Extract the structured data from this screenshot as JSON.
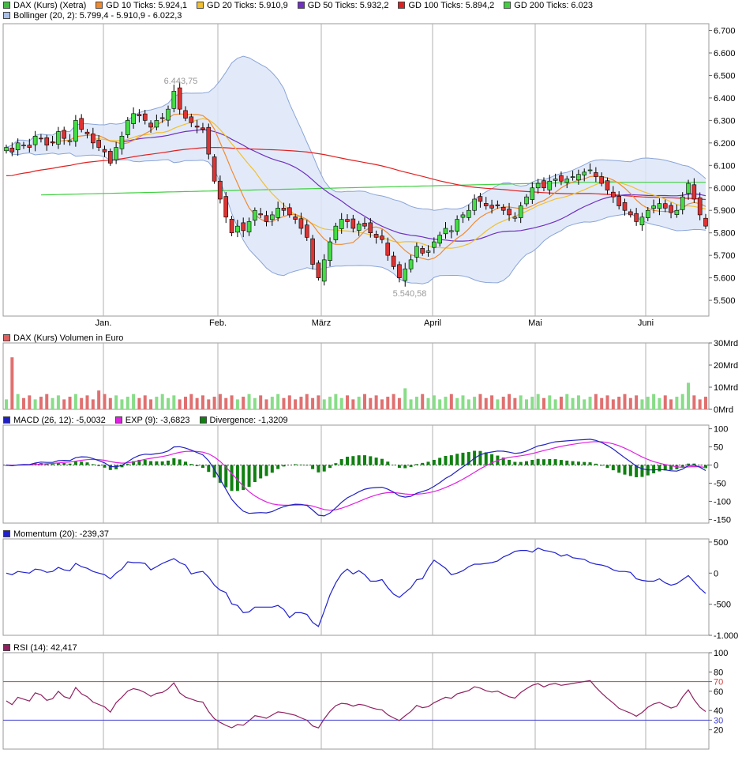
{
  "legends": {
    "price": [
      {
        "label": "DAX (Kurs) (Xetra)",
        "color": "#44bb44"
      },
      {
        "label": "GD 10 Ticks: 5.924,1",
        "color": "#f08a30"
      },
      {
        "label": "GD 20 Ticks: 5.910,9",
        "color": "#f0c030"
      },
      {
        "label": "GD 50 Ticks: 5.932,2",
        "color": "#7030c0"
      },
      {
        "label": "GD 100 Ticks: 5.894,2",
        "color": "#e02020"
      },
      {
        "label": "GD 200 Ticks: 6.023",
        "color": "#40d040"
      }
    ],
    "bollinger": {
      "label": "Bollinger (20, 2): 5.799,4 - 5.910,9 - 6.022,3",
      "color": "#a8c0e8"
    },
    "volume": {
      "label": "DAX (Kurs) Volumen in Euro",
      "color": "#e06060"
    },
    "macd": [
      {
        "label": "MACD (26, 12): -5,0032",
        "color": "#2020c0"
      },
      {
        "label": "EXP (9): -3,6823",
        "color": "#e020e0"
      },
      {
        "label": "Divergence: -1,3209",
        "color": "#108010"
      }
    ],
    "momentum": {
      "label": "Momentum (20): -239,37",
      "color": "#2020d0"
    },
    "rsi": {
      "label": "RSI (14): 42,417",
      "color": "#902060"
    }
  },
  "chart_data": [
    {
      "type": "candlestick",
      "name": "price",
      "x_months": [
        "Jan.",
        "Feb.",
        "März",
        "April",
        "Mai",
        "Juni"
      ],
      "ylim": [
        5430,
        6730
      ],
      "yticks": [
        "5.500",
        "5.600",
        "5.700",
        "5.800",
        "5.900",
        "6.000",
        "6.100",
        "6.200",
        "6.300",
        "6.400",
        "6.500",
        "6.600",
        "6.700"
      ],
      "annotations": [
        "6.443,75",
        "5.540,58"
      ],
      "close": [
        6180,
        6160,
        6200,
        6190,
        6180,
        6230,
        6220,
        6190,
        6200,
        6250,
        6220,
        6210,
        6300,
        6260,
        6240,
        6200,
        6180,
        6160,
        6110,
        6180,
        6230,
        6300,
        6330,
        6320,
        6300,
        6270,
        6300,
        6310,
        6350,
        6430,
        6350,
        6310,
        6290,
        6270,
        6260,
        6150,
        6030,
        5950,
        5870,
        5800,
        5830,
        5810,
        5850,
        5900,
        5880,
        5850,
        5880,
        5910,
        5900,
        5880,
        5860,
        5820,
        5780,
        5660,
        5600,
        5680,
        5760,
        5830,
        5860,
        5850,
        5820,
        5840,
        5830,
        5800,
        5780,
        5770,
        5700,
        5650,
        5600,
        5640,
        5680,
        5740,
        5710,
        5720,
        5760,
        5790,
        5820,
        5810,
        5860,
        5880,
        5900,
        5950,
        5940,
        5920,
        5910,
        5920,
        5900,
        5880,
        5870,
        5920,
        5960,
        6000,
        6020,
        6000,
        6030,
        6040,
        6030,
        6040,
        6050,
        6060,
        6070,
        6080,
        6050,
        6020,
        5990,
        5960,
        5920,
        5900,
        5880,
        5850,
        5870,
        5900,
        5920,
        5930,
        5910,
        5890,
        5900,
        5960,
        6020,
        5950,
        5880,
        5830
      ],
      "ma_values": [
        "5.924,1",
        "5.910,9",
        "5.932,2",
        "5.894,2",
        "6.023"
      ]
    },
    {
      "type": "bar",
      "name": "volume",
      "yticks": [
        "0Mrd",
        "10Mrd",
        "20Mrd",
        "30Mrd"
      ],
      "ylim": [
        0,
        30
      ],
      "unit": "Mrd"
    },
    {
      "type": "line",
      "name": "macd",
      "yticks": [
        "-150",
        "-100",
        "-50",
        "0",
        "50",
        "100"
      ],
      "ylim": [
        -160,
        110
      ]
    },
    {
      "type": "line",
      "name": "momentum",
      "yticks": [
        "-1.000",
        "-500",
        "0",
        "500"
      ],
      "ylim": [
        -1000,
        550
      ]
    },
    {
      "type": "line",
      "name": "rsi",
      "yticks": [
        "20",
        "30",
        "40",
        "60",
        "70",
        "80",
        "100"
      ],
      "ylim": [
        0,
        100
      ],
      "levels": [
        70,
        30
      ]
    }
  ]
}
